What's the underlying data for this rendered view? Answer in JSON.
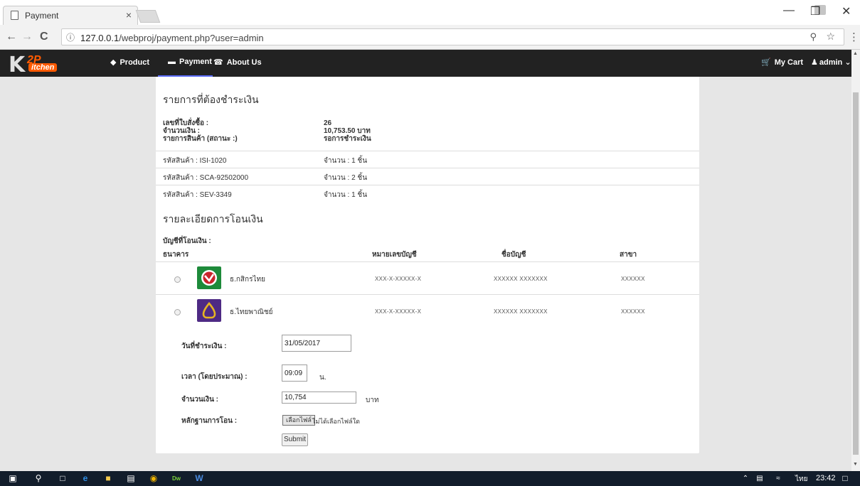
{
  "browser": {
    "tab_title": "Payment",
    "tab_close": "×",
    "url_host": "127.0.0.1",
    "url_path": "/webproj/payment.php?user=admin",
    "info_icon": "ⓘ",
    "back": "←",
    "forward": "→",
    "reload": "C",
    "zoom": "⚲",
    "star": "☆",
    "menu": "⋮",
    "minimize": "—",
    "restore": "❐",
    "close": "✕"
  },
  "navbar": {
    "logo_k": "K",
    "logo_2p": "2P",
    "logo_itchen": "itchen",
    "product": "Product",
    "payment": "Payment",
    "about": "About Us",
    "cart": "My Cart",
    "user": "admin",
    "product_icon": "tag-icon",
    "payment_icon": "credit-card-icon",
    "about_icon": "phone-icon",
    "cart_icon": "cart-icon",
    "user_icon": "user-icon"
  },
  "order": {
    "heading": "รายการที่ต้องชำระเงิน",
    "label_order_no": "เลขที่ใบสั่งซื้อ :",
    "label_amount": "จำนวนเงิน :",
    "label_items": "รายการสินค้า (สถานะ :)",
    "order_no": "26",
    "amount": "10,753.50 บาท",
    "status": "รอการชำระเงิน",
    "items": [
      {
        "code": "รหัสสินค้า : ISI-1020",
        "qty": "จำนวน : 1 ชิ้น"
      },
      {
        "code": "รหัสสินค้า : SCA-92502000",
        "qty": "จำนวน : 2 ชิ้น"
      },
      {
        "code": "รหัสสินค้า : SEV-3349",
        "qty": "จำนวน : 1 ชิ้น"
      }
    ]
  },
  "transfer": {
    "heading": "รายละเอียดการโอนเงิน",
    "account_label": "บัญชีที่โอนเงิน :",
    "col_bank": "ธนาคาร",
    "col_acct_no": "หมายเลขบัญชี",
    "col_acct_name": "ชื่อบัญชี",
    "col_branch": "สาขา",
    "banks": [
      {
        "name": "ธ.กสิกรไทย",
        "acct_no": "XXX-X-XXXXX-X",
        "acct_name": "XXXXXX XXXXXXX",
        "branch": "XXXXXX",
        "color": "#1d8a3a"
      },
      {
        "name": "ธ.ไทยพาณิชย์",
        "acct_no": "XXX-X-XXXXX-X",
        "acct_name": "XXXXXX XXXXXXX",
        "branch": "XXXXXX",
        "color": "#4e2a84"
      }
    ]
  },
  "form": {
    "date_label": "วันที่ชำระเงิน :",
    "date_value": "31/05/2017",
    "time_label": "เวลา (โดยประมาณ) :",
    "time_value": "09:09",
    "time_unit": "น.",
    "amount_label": "จำนวนเงิน :",
    "amount_value": "10,754",
    "amount_unit": "บาท",
    "proof_label": "หลักฐานการโอน :",
    "file_button": "เลือกไฟล์",
    "file_note": "ไม่ได้เลือกไฟล์ใด",
    "submit": "Submit"
  },
  "taskbar": {
    "lang": "ไทย",
    "time": "23:42"
  }
}
